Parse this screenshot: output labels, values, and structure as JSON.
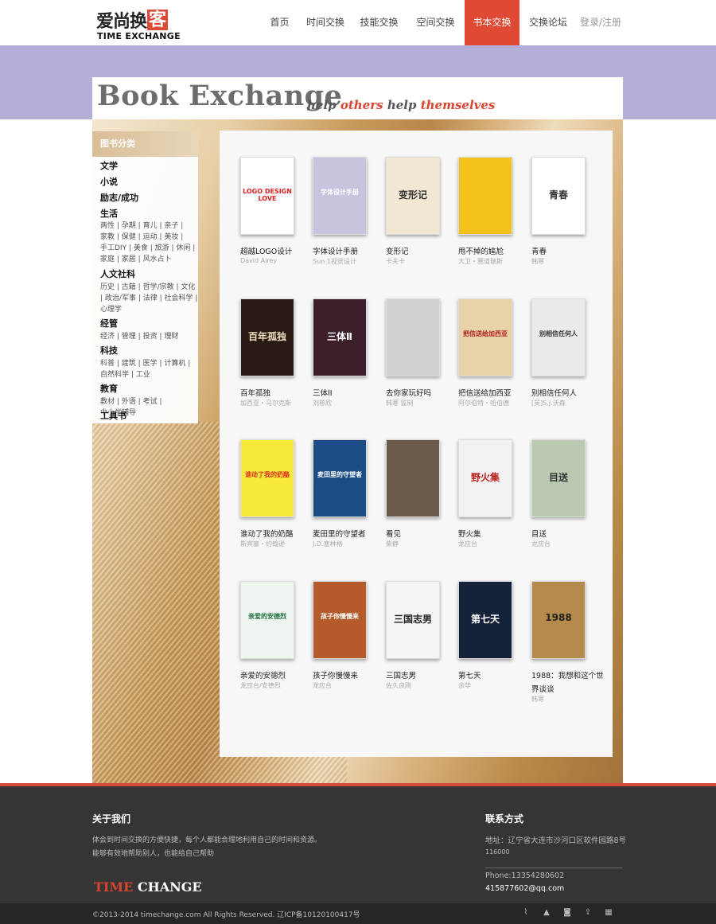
{
  "nav": {
    "logo_cn": "爱尚换",
    "logo_cn_box": "客",
    "logo_en": "TIME EXCHANGE",
    "items": [
      {
        "label": "首页"
      },
      {
        "label": "时间交换"
      },
      {
        "label": "技能交换"
      },
      {
        "label": "空间交换"
      },
      {
        "label": "书本交换"
      },
      {
        "label": "交换论坛"
      }
    ],
    "active_index": 4,
    "login": "登录/注册"
  },
  "banner": {
    "title": "Book Exchange",
    "tag_1": "help",
    "tag_2": "others",
    "tag_3": "help",
    "tag_4": "themselves"
  },
  "sidebar": {
    "header": "图书分类",
    "categories": [
      {
        "name": "文学"
      },
      {
        "name": "小说"
      },
      {
        "name": "励志/成功"
      },
      {
        "name": "生活",
        "subs": [
          "两性",
          "孕期",
          "育儿",
          "亲子",
          "家教",
          "保健",
          "运动",
          "美妆",
          "手工DIY",
          "美食",
          "旅游",
          "休闲",
          "家庭",
          "家居",
          "风水占卜"
        ]
      },
      {
        "name": "人文社科",
        "subs": [
          "历史",
          "古籍",
          "哲学/宗教",
          "文化",
          "政治/军事",
          "法律",
          "社会科学",
          "心理学"
        ]
      },
      {
        "name": "经管",
        "subs": [
          "经济",
          "管理",
          "投资",
          "理财"
        ]
      },
      {
        "name": "科技",
        "subs": [
          "科普",
          "建筑",
          "医学",
          "计算机",
          "自然科学",
          "工业"
        ]
      },
      {
        "name": "教育",
        "subs": [
          "教材",
          "外语",
          "考试",
          "中小学辅导"
        ]
      },
      {
        "name": "工具书"
      }
    ]
  },
  "books": [
    {
      "title": "超越LOGO设计",
      "author": "David Airey",
      "cover": "#ffffff",
      "cover_text": "LOGO DESIGN LOVE",
      "text_color": "#e02020"
    },
    {
      "title": "字体设计手册",
      "author": "Sun 1视觉设计",
      "cover": "#c9c3dd",
      "cover_text": "字体设计手册",
      "text_color": "#ffffff"
    },
    {
      "title": "变形记",
      "author": "卡夫卡",
      "cover": "#f1e7d2",
      "cover_text": "变形记",
      "text_color": "#333333"
    },
    {
      "title": "甩不掉的尴尬",
      "author": "大卫・赛道瑞斯",
      "cover": "#f3c21a",
      "cover_text": "",
      "text_color": "#222222"
    },
    {
      "title": "青春",
      "author": "韩寒",
      "cover": "#ffffff",
      "cover_text": "青春",
      "text_color": "#333333"
    },
    {
      "title": "百年孤独",
      "author": "加西亚・马尔克斯",
      "cover": "#2a1a14",
      "cover_text": "百年孤独",
      "text_color": "#f0e0c0"
    },
    {
      "title": "三体II",
      "author": "刘慈欣",
      "cover": "#3c1e2c",
      "cover_text": "三体Ⅱ",
      "text_color": "#ffffff"
    },
    {
      "title": "去你家玩好吗",
      "author": "韩寒 监制",
      "cover": "#d0d0d0",
      "cover_text": "",
      "text_color": "#333333"
    },
    {
      "title": "把信送给加西亚",
      "author": "阿尔伯特・哈伯德",
      "cover": "#e8d2a8",
      "cover_text": "把信送给加西亚",
      "text_color": "#b02020"
    },
    {
      "title": "别相信任何人",
      "author": "[英]S.J.沃森",
      "cover": "#eaeaea",
      "cover_text": "别相信任何人",
      "text_color": "#333333"
    },
    {
      "title": "谁动了我的奶酪",
      "author": "斯宾塞・约翰逊",
      "cover": "#f7ea3a",
      "cover_text": "谁动了我的奶酪",
      "text_color": "#e03020"
    },
    {
      "title": "麦田里的守望者",
      "author": "J.D.塞林格",
      "cover": "#1c4d86",
      "cover_text": "麦田里的守望者",
      "text_color": "#ffffff"
    },
    {
      "title": "看见",
      "author": "柴静",
      "cover": "#6a5a4a",
      "cover_text": "",
      "text_color": "#ffffff"
    },
    {
      "title": "野火集",
      "author": "龙应台",
      "cover": "#f2f2f2",
      "cover_text": "野火集",
      "text_color": "#c02020"
    },
    {
      "title": "目送",
      "author": "龙应台",
      "cover": "#b9c9b2",
      "cover_text": "目送",
      "text_color": "#333333"
    },
    {
      "title": "亲爱的安德烈",
      "author": "龙应台/安德烈",
      "cover": "#eef4ee",
      "cover_text": "亲爱的安德烈",
      "text_color": "#207040"
    },
    {
      "title": "孩子你慢慢来",
      "author": "龙应台",
      "cover": "#b55a2a",
      "cover_text": "孩子你慢慢来",
      "text_color": "#ffffff"
    },
    {
      "title": "三国志男",
      "author": "佐久良刚",
      "cover": "#f4f4f4",
      "cover_text": "三国志男",
      "text_color": "#222222"
    },
    {
      "title": "第七天",
      "author": "余华",
      "cover": "#14223a",
      "cover_text": "第七天",
      "text_color": "#ffffff"
    },
    {
      "title": "1988：我想和这个世界谈谈",
      "author": "韩寒",
      "cover": "#b58a4a",
      "cover_text": "1988",
      "text_color": "#222222"
    }
  ],
  "footer": {
    "about_title": "关于我们",
    "about_line1": "体会到时间交换的方便快捷，每个人都能合理地利用自己的时间和资源。",
    "about_line2": "能够有效地帮助别人，也能给自己帮助",
    "logo_r": "TIME",
    "logo_w": "CHANGE",
    "contact_title": "联系方式",
    "address": "地址：辽宁省大连市沙河口区软件园路8号",
    "zip": "116000",
    "phone": "Phone:13354280602",
    "email": "415877602@qq.com"
  },
  "copyright": "©2013-2014 timechange.com All Rights Reserved. 辽ICP备10120100417号",
  "social_icons": [
    "rss-icon",
    "tent-icon",
    "instagram-icon",
    "share-icon",
    "qrcode-icon"
  ]
}
